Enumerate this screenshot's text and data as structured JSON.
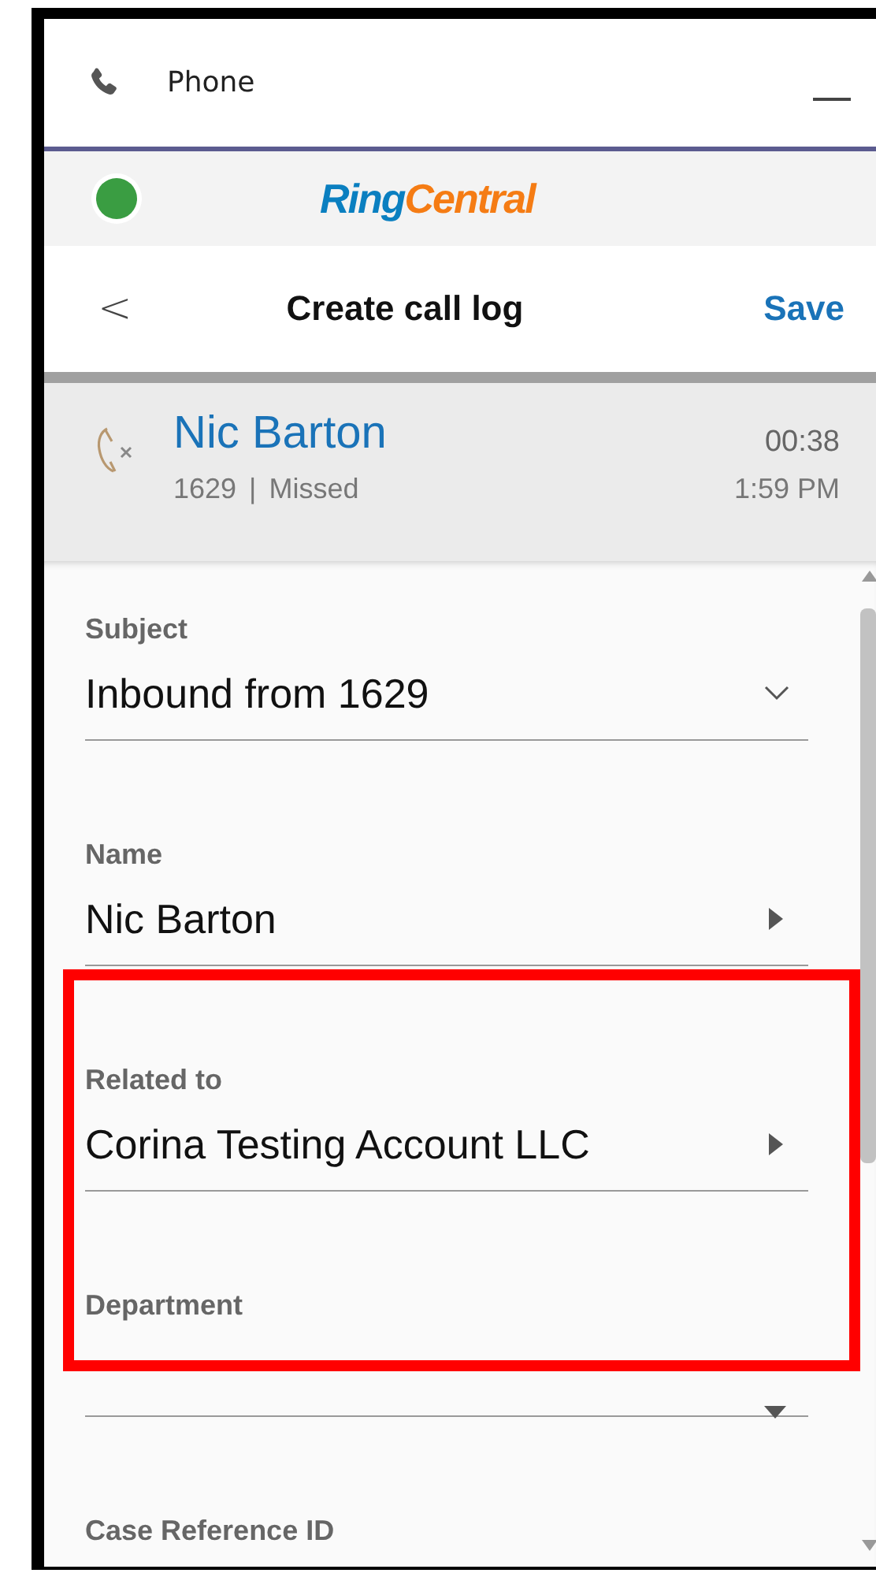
{
  "window": {
    "title": "Phone"
  },
  "brand": {
    "logo_part_1": "Ring",
    "logo_part_2": "Central",
    "status_online": true
  },
  "nav": {
    "back": "<",
    "title": "Create call log",
    "save": "Save"
  },
  "call": {
    "name": "Nic Barton",
    "number": "1629",
    "separator": "|",
    "status": "Missed",
    "duration": "00:38",
    "time": "1:59 PM"
  },
  "fields": [
    {
      "kind": "select",
      "label": "Subject",
      "value": "Inbound from 1629",
      "highlighted": false
    },
    {
      "kind": "lookup",
      "label": "Name",
      "value": "Nic Barton",
      "highlighted": false
    },
    {
      "kind": "lookup",
      "label": "Related to",
      "value": "Corina Testing Account LLC",
      "highlighted": true
    },
    {
      "kind": "picklist",
      "label": "Department",
      "highlighted": true
    },
    {
      "kind": "text",
      "label": "Case Reference ID",
      "highlighted": false
    }
  ]
}
